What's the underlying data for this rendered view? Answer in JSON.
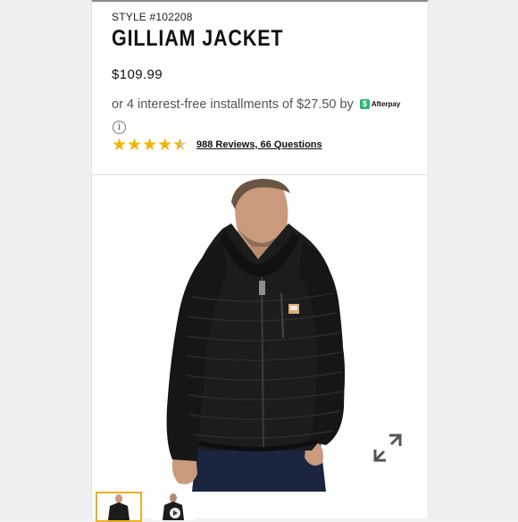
{
  "product": {
    "style_number": "STYLE #102208",
    "name": "GILLIAM JACKET",
    "price": "$109.99",
    "installments_text": "or 4 interest-free installments of $27.50 by",
    "afterpay_label": "Afterpay",
    "afterpay_badge": "$",
    "info_glyph": "i",
    "rating": 4.5,
    "rating_max": 5,
    "reviews_link": "988 Reviews, 66 Questions"
  },
  "gallery": {
    "thumbnails": [
      "jacket-front",
      "video"
    ],
    "selected_thumbnail": 0
  },
  "colors": {
    "star": "#f2b400",
    "afterpay_green": "#2bb673",
    "thumb_active_border": "#e6b422",
    "jacket": "#1b1b1b"
  }
}
